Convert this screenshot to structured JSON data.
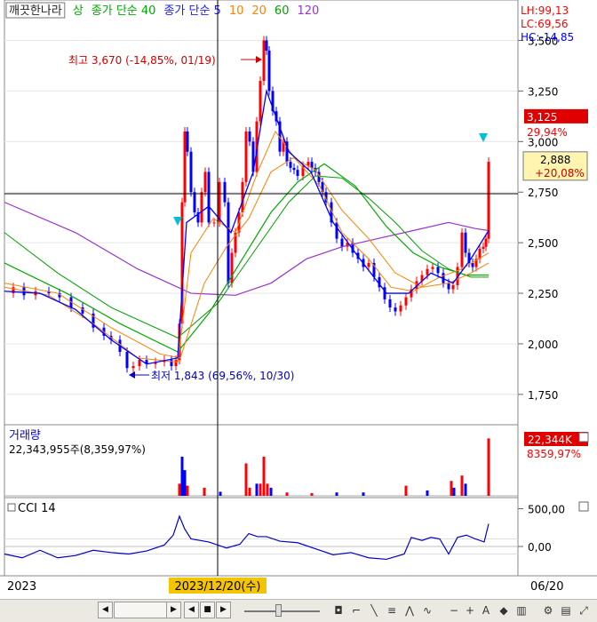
{
  "legend": [
    {
      "text": "깨끗한나라",
      "color": "#222222",
      "boxed": true
    },
    {
      "text": "상",
      "color": "#00aa00"
    },
    {
      "text": "종가 단순 40",
      "color": "#00aa00"
    },
    {
      "text": "종가 단순 5",
      "color": "#1a1aff"
    },
    {
      "text": "10",
      "color": "#ff7f00"
    },
    {
      "text": "20",
      "color": "#ff7f00"
    },
    {
      "text": "60",
      "color": "#00a000"
    },
    {
      "text": "120",
      "color": "#9933cc"
    }
  ],
  "stats": [
    {
      "text": "LH:99,13",
      "color": "#ff0000"
    },
    {
      "text": "LC:69,56",
      "color": "#ff0000"
    },
    {
      "text": "HC:-14,85",
      "color": "#0000ff"
    }
  ],
  "colors": {
    "up": "#ff0000",
    "down": "#0000ff",
    "ma5": "#0000ff",
    "ma10": "#ff7f00",
    "ma20": "#ff7f00",
    "ma40": "#00aa00",
    "ma60": "#00a000",
    "ma120": "#9933cc",
    "cci": "#0000cc"
  },
  "chart_data": [
    {
      "type": "candlestick",
      "ylim": [
        1600,
        3700
      ],
      "yticks": [
        "3,500",
        "3,250",
        "3,000",
        "2,750",
        "2,500",
        "2,250",
        "2,000",
        "1,750"
      ],
      "annotations": {
        "high_label": "최고 3,670 (-14,85%, 01/19)",
        "low_label": "최저 1,843 (69,56%, 10/30)",
        "last_price": "3,125",
        "last_change": "29,94%",
        "cursor_price": "2,888",
        "cursor_change": "+20,08%"
      },
      "series_path": [
        [
          0,
          2250
        ],
        [
          10,
          2280
        ],
        [
          22,
          2240
        ],
        [
          35,
          2260
        ],
        [
          50,
          2250
        ],
        [
          62,
          2230
        ],
        [
          75,
          2180
        ],
        [
          88,
          2150
        ],
        [
          100,
          2080
        ],
        [
          112,
          2040
        ],
        [
          120,
          2020
        ],
        [
          130,
          1960
        ],
        [
          138,
          1880
        ],
        [
          145,
          1890
        ],
        [
          152,
          1920
        ],
        [
          160,
          1900
        ],
        [
          170,
          1910
        ],
        [
          180,
          1920
        ],
        [
          188,
          1890
        ],
        [
          193,
          1920
        ],
        [
          197,
          2100
        ],
        [
          200,
          2700
        ],
        [
          203,
          3050
        ],
        [
          206,
          2950
        ],
        [
          210,
          2750
        ],
        [
          214,
          2650
        ],
        [
          218,
          2600
        ],
        [
          222,
          2750
        ],
        [
          226,
          2850
        ],
        [
          230,
          2600
        ],
        [
          236,
          2600
        ],
        [
          242,
          2800
        ],
        [
          248,
          2700
        ],
        [
          252,
          2300
        ],
        [
          256,
          2450
        ],
        [
          260,
          2550
        ],
        [
          264,
          2650
        ],
        [
          268,
          2800
        ],
        [
          272,
          3050
        ],
        [
          276,
          3000
        ],
        [
          280,
          2850
        ],
        [
          284,
          3100
        ],
        [
          288,
          3300
        ],
        [
          292,
          3500
        ],
        [
          295,
          3450
        ],
        [
          298,
          3250
        ],
        [
          302,
          3150
        ],
        [
          306,
          3100
        ],
        [
          310,
          2950
        ],
        [
          314,
          3000
        ],
        [
          318,
          2900
        ],
        [
          322,
          2870
        ],
        [
          326,
          2860
        ],
        [
          330,
          2830
        ],
        [
          336,
          2880
        ],
        [
          342,
          2900
        ],
        [
          346,
          2870
        ],
        [
          350,
          2850
        ],
        [
          354,
          2800
        ],
        [
          358,
          2750
        ],
        [
          362,
          2700
        ],
        [
          368,
          2600
        ],
        [
          374,
          2520
        ],
        [
          380,
          2480
        ],
        [
          386,
          2500
        ],
        [
          392,
          2450
        ],
        [
          398,
          2420
        ],
        [
          404,
          2380
        ],
        [
          410,
          2400
        ],
        [
          416,
          2330
        ],
        [
          422,
          2280
        ],
        [
          428,
          2220
        ],
        [
          434,
          2180
        ],
        [
          440,
          2160
        ],
        [
          446,
          2190
        ],
        [
          452,
          2230
        ],
        [
          458,
          2270
        ],
        [
          464,
          2310
        ],
        [
          470,
          2340
        ],
        [
          476,
          2370
        ],
        [
          482,
          2380
        ],
        [
          488,
          2350
        ],
        [
          494,
          2300
        ],
        [
          500,
          2270
        ],
        [
          505,
          2290
        ],
        [
          510,
          2380
        ],
        [
          515,
          2550
        ],
        [
          519,
          2450
        ],
        [
          523,
          2400
        ],
        [
          527,
          2380
        ],
        [
          531,
          2420
        ],
        [
          535,
          2470
        ],
        [
          539,
          2480
        ],
        [
          542,
          2520
        ],
        [
          545,
          2900
        ]
      ],
      "ma5": [
        [
          0,
          2260
        ],
        [
          40,
          2250
        ],
        [
          80,
          2170
        ],
        [
          120,
          2020
        ],
        [
          160,
          1900
        ],
        [
          195,
          1930
        ],
        [
          205,
          2600
        ],
        [
          230,
          2680
        ],
        [
          255,
          2550
        ],
        [
          280,
          2850
        ],
        [
          295,
          3250
        ],
        [
          320,
          2950
        ],
        [
          345,
          2850
        ],
        [
          370,
          2600
        ],
        [
          400,
          2420
        ],
        [
          430,
          2250
        ],
        [
          455,
          2250
        ],
        [
          480,
          2350
        ],
        [
          505,
          2300
        ],
        [
          525,
          2420
        ],
        [
          545,
          2560
        ]
      ],
      "ma10": [
        [
          0,
          2280
        ],
        [
          50,
          2240
        ],
        [
          100,
          2100
        ],
        [
          150,
          1930
        ],
        [
          195,
          1910
        ],
        [
          210,
          2450
        ],
        [
          235,
          2620
        ],
        [
          260,
          2550
        ],
        [
          285,
          2850
        ],
        [
          305,
          3050
        ],
        [
          330,
          2900
        ],
        [
          355,
          2780
        ],
        [
          380,
          2550
        ],
        [
          410,
          2420
        ],
        [
          435,
          2280
        ],
        [
          460,
          2260
        ],
        [
          490,
          2330
        ],
        [
          515,
          2370
        ],
        [
          545,
          2450
        ]
      ],
      "ma20": [
        [
          0,
          2300
        ],
        [
          60,
          2250
        ],
        [
          120,
          2080
        ],
        [
          175,
          1950
        ],
        [
          198,
          1930
        ],
        [
          225,
          2300
        ],
        [
          250,
          2480
        ],
        [
          275,
          2620
        ],
        [
          300,
          2850
        ],
        [
          325,
          2920
        ],
        [
          350,
          2860
        ],
        [
          380,
          2660
        ],
        [
          410,
          2520
        ],
        [
          440,
          2350
        ],
        [
          470,
          2280
        ],
        [
          500,
          2300
        ],
        [
          525,
          2350
        ],
        [
          545,
          2400
        ]
      ],
      "ma40": [
        [
          0,
          2400
        ],
        [
          70,
          2250
        ],
        [
          130,
          2100
        ],
        [
          195,
          1960
        ],
        [
          230,
          2150
        ],
        [
          265,
          2400
        ],
        [
          300,
          2650
        ],
        [
          330,
          2800
        ],
        [
          360,
          2890
        ],
        [
          395,
          2780
        ],
        [
          430,
          2580
        ],
        [
          460,
          2450
        ],
        [
          490,
          2380
        ],
        [
          520,
          2340
        ],
        [
          545,
          2340
        ]
      ],
      "ma60": [
        [
          0,
          2550
        ],
        [
          60,
          2350
        ],
        [
          120,
          2180
        ],
        [
          195,
          2030
        ],
        [
          240,
          2200
        ],
        [
          280,
          2450
        ],
        [
          320,
          2700
        ],
        [
          350,
          2830
        ],
        [
          380,
          2820
        ],
        [
          410,
          2720
        ],
        [
          440,
          2600
        ],
        [
          470,
          2460
        ],
        [
          500,
          2370
        ],
        [
          525,
          2330
        ],
        [
          545,
          2330
        ]
      ],
      "ma120": [
        [
          0,
          2700
        ],
        [
          80,
          2550
        ],
        [
          150,
          2370
        ],
        [
          210,
          2250
        ],
        [
          260,
          2240
        ],
        [
          300,
          2300
        ],
        [
          340,
          2420
        ],
        [
          380,
          2480
        ],
        [
          420,
          2520
        ],
        [
          460,
          2560
        ],
        [
          500,
          2600
        ],
        [
          530,
          2570
        ],
        [
          545,
          2560
        ]
      ]
    },
    {
      "type": "bar",
      "title": "거래량",
      "value_text": "22,343,955주(8,359,97%)",
      "badge_value": "22,344K",
      "badge_change": "8359,97%",
      "bars": [
        [
          197,
          0.18,
          "up"
        ],
        [
          200,
          0.58,
          "down"
        ],
        [
          203,
          0.38,
          "down"
        ],
        [
          206,
          0.15,
          "up"
        ],
        [
          225,
          0.12,
          "up"
        ],
        [
          243,
          0.06,
          "down"
        ],
        [
          272,
          0.48,
          "up"
        ],
        [
          276,
          0.12,
          "up"
        ],
        [
          284,
          0.18,
          "down"
        ],
        [
          288,
          0.18,
          "up"
        ],
        [
          292,
          0.58,
          "up"
        ],
        [
          296,
          0.18,
          "up"
        ],
        [
          300,
          0.12,
          "down"
        ],
        [
          318,
          0.05,
          "up"
        ],
        [
          346,
          0.04,
          "up"
        ],
        [
          374,
          0.05,
          "down"
        ],
        [
          404,
          0.05,
          "down"
        ],
        [
          452,
          0.15,
          "up"
        ],
        [
          476,
          0.08,
          "down"
        ],
        [
          503,
          0.22,
          "up"
        ],
        [
          506,
          0.12,
          "down"
        ],
        [
          515,
          0.3,
          "up"
        ],
        [
          519,
          0.18,
          "down"
        ],
        [
          545,
          0.85,
          "up"
        ]
      ]
    },
    {
      "type": "line",
      "title": "CCI 14",
      "yticks": [
        "500,00",
        "0,00"
      ],
      "series": [
        [
          0,
          -100
        ],
        [
          20,
          -150
        ],
        [
          40,
          -50
        ],
        [
          60,
          -150
        ],
        [
          80,
          -120
        ],
        [
          100,
          -50
        ],
        [
          120,
          -80
        ],
        [
          140,
          -100
        ],
        [
          160,
          -60
        ],
        [
          180,
          20
        ],
        [
          190,
          150
        ],
        [
          197,
          400
        ],
        [
          203,
          230
        ],
        [
          210,
          100
        ],
        [
          230,
          60
        ],
        [
          250,
          -20
        ],
        [
          265,
          30
        ],
        [
          275,
          170
        ],
        [
          285,
          130
        ],
        [
          295,
          130
        ],
        [
          310,
          70
        ],
        [
          330,
          50
        ],
        [
          350,
          -30
        ],
        [
          370,
          -110
        ],
        [
          390,
          -80
        ],
        [
          410,
          -150
        ],
        [
          430,
          -170
        ],
        [
          450,
          -100
        ],
        [
          458,
          120
        ],
        [
          470,
          80
        ],
        [
          480,
          120
        ],
        [
          490,
          100
        ],
        [
          500,
          -100
        ],
        [
          510,
          120
        ],
        [
          520,
          150
        ],
        [
          530,
          100
        ],
        [
          540,
          60
        ],
        [
          545,
          300
        ]
      ]
    }
  ],
  "axis": {
    "date_left": "2023",
    "cursor_date": "2023/12/20(수)",
    "date_right": "06/20"
  }
}
